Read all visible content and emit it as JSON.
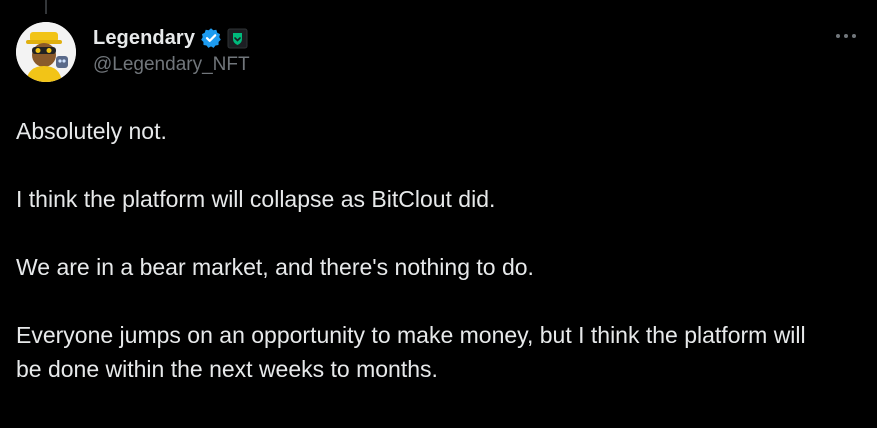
{
  "tweet": {
    "author": {
      "display_name": "Legendary",
      "handle": "@Legendary_NFT",
      "avatar_icon": "cartoon-avatar-icon",
      "verified_icon": "verified-badge-icon",
      "verified_color": "#1d9bf0",
      "affiliate_icon": "affiliate-badge-icon",
      "affiliate_color": "#00ba7c"
    },
    "more_icon": "more-options-icon",
    "paragraphs": [
      "Absolutely not.",
      "I think the platform will collapse as BitClout did.",
      "We are in a bear market, and there's nothing to do.",
      "Everyone jumps on an opportunity to make money, but I think the platform will be done within the next weeks to months."
    ]
  },
  "colors": {
    "background": "#000000",
    "text_primary": "#e7e9ea",
    "text_secondary": "#71767b"
  }
}
